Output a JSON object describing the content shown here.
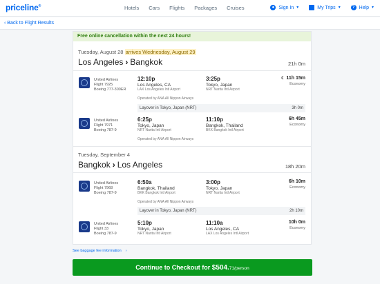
{
  "header": {
    "logo": "priceline",
    "logo_mark": "®",
    "nav": [
      "Hotels",
      "Cars",
      "Flights",
      "Packages",
      "Cruises"
    ],
    "sign_in": "Sign In",
    "my_trips": "My Trips",
    "help": "Help"
  },
  "back_link": "‹ Back to Flight Results",
  "banner": "Free online cancellation within the next 24 hours!",
  "outbound": {
    "date": "Tuesday, August 28",
    "arrives": "arrives Wednesday, August 29",
    "origin": "Los Angeles",
    "separator": "›",
    "destination": "Bangkok",
    "duration": "21h 0m",
    "segments": [
      {
        "airline": "United Airlines",
        "flight": "Flight 7925",
        "aircraft": "Boeing 777-300ER",
        "dep_time": "12:10p",
        "dep_city": "Los Angeles, CA",
        "dep_airport": "LAX Los Angeles Intl Airport",
        "arr_time": "3:25p",
        "arr_city": "Tokyo, Japan",
        "arr_airport": "NRT Narita Intl Airport",
        "duration": "11h 15m",
        "cabin": "Economy",
        "operated": "Operated by ANA All Nippon Airways"
      },
      {
        "airline": "United Airlines",
        "flight": "Flight 7971",
        "aircraft": "Boeing 787-9",
        "dep_time": "6:25p",
        "dep_city": "Tokyo, Japan",
        "dep_airport": "NRT Narita Intl Airport",
        "arr_time": "11:10p",
        "arr_city": "Bangkok, Thailand",
        "arr_airport": "BKK Bangkok Intl Airport",
        "duration": "6h 45m",
        "cabin": "Economy",
        "operated": "Operated by ANA All Nippon Airways"
      }
    ],
    "layover": {
      "label": "Layover in Tokyo, Japan (NRT)",
      "time": "3h 0m"
    }
  },
  "return": {
    "date": "Tuesday, September 4",
    "origin": "Bangkok",
    "separator": "›",
    "destination": "Los Angeles",
    "duration": "18h 20m",
    "segments": [
      {
        "airline": "United Airlines",
        "flight": "Flight 7968",
        "aircraft": "Boeing 787-9",
        "dep_time": "6:50a",
        "dep_city": "Bangkok, Thailand",
        "dep_airport": "BKK Bangkok Intl Airport",
        "arr_time": "3:00p",
        "arr_city": "Tokyo, Japan",
        "arr_airport": "NRT Narita Intl Airport",
        "duration": "6h 10m",
        "cabin": "Economy",
        "operated": "Operated by ANA All Nippon Airways"
      },
      {
        "airline": "United Airlines",
        "flight": "Flight 33",
        "aircraft": "Boeing 787-9",
        "dep_time": "5:10p",
        "dep_city": "Tokyo, Japan",
        "dep_airport": "NRT Narita Intl Airport",
        "arr_time": "11:10a",
        "arr_city": "Los Angeles, CA",
        "arr_airport": "LAX Los Angeles Intl Airport",
        "duration": "10h 0m",
        "cabin": "Economy"
      }
    ],
    "layover": {
      "label": "Layover in Tokyo, Japan (NRT)",
      "time": "2h 10m"
    }
  },
  "baggage_link": "See baggage fee information",
  "checkout": {
    "label": "Continue to Checkout for ",
    "price": "$504.",
    "cents": "71",
    "per": "/person"
  }
}
